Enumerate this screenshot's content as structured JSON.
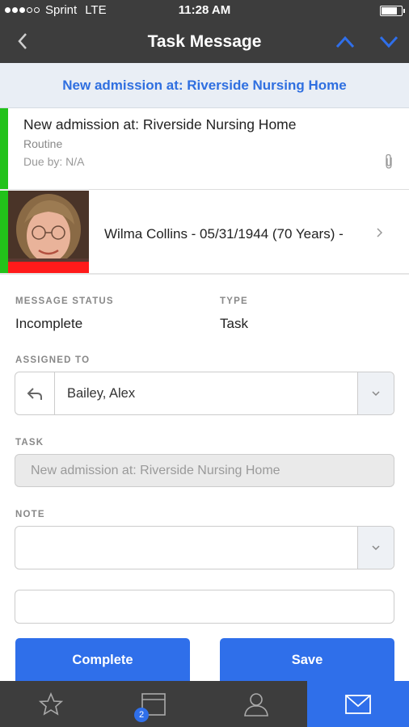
{
  "status_bar": {
    "carrier": "Sprint",
    "network": "LTE",
    "time": "11:28 AM"
  },
  "nav": {
    "title": "Task Message"
  },
  "banner": {
    "subject": "New admission at: Riverside Nursing Home"
  },
  "message": {
    "subject": "New admission at: Riverside Nursing Home",
    "priority": "Routine",
    "due": "Due by: N/A"
  },
  "patient": {
    "summary": "Wilma Collins - 05/31/1944 (70 Years) -"
  },
  "form": {
    "message_status_label": "MESSAGE STATUS",
    "message_status_value": "Incomplete",
    "type_label": "TYPE",
    "type_value": "Task",
    "assigned_to_label": "ASSIGNED TO",
    "assigned_to_value": "Bailey, Alex",
    "task_label": "TASK",
    "task_value": "New admission at: Riverside Nursing Home",
    "note_label": "NOTE",
    "note_value": "",
    "text_value": ""
  },
  "buttons": {
    "complete": "Complete",
    "save": "Save"
  },
  "tabbar": {
    "inbox_badge": "2",
    "active_tab": "messages"
  },
  "colors": {
    "accent": "#2f6fea",
    "status_green": "#22c21a",
    "alert_red": "#ff1a1a",
    "bar_dark": "#3d3d3d"
  },
  "icons": [
    "back-chevron-icon",
    "up-arrow-icon",
    "down-arrow-icon",
    "paperclip-icon",
    "chevron-right-icon",
    "reply-icon",
    "chevron-down-icon",
    "star-icon",
    "inbox-icon",
    "person-icon",
    "mail-icon"
  ]
}
